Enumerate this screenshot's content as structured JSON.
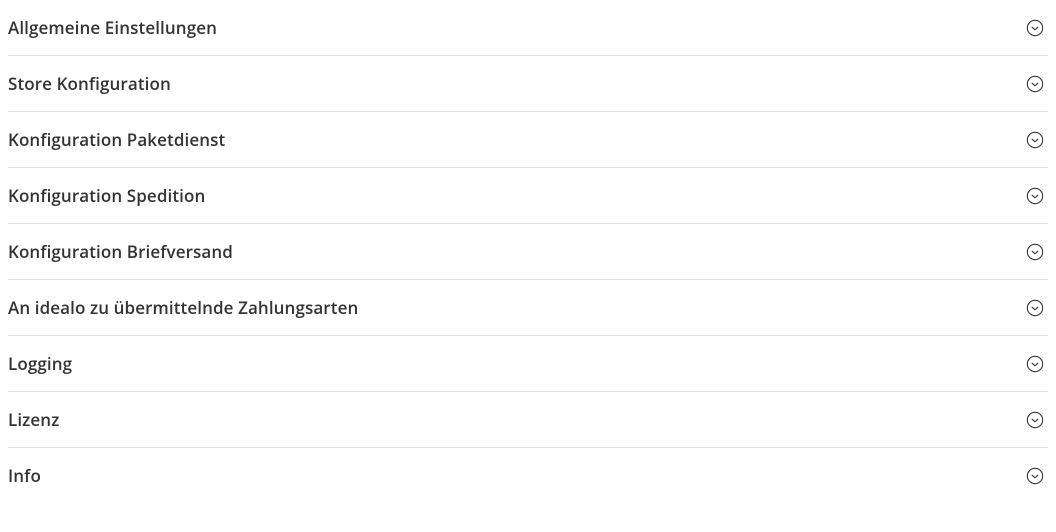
{
  "accordion": {
    "items": [
      {
        "label": "Allgemeine Einstellungen"
      },
      {
        "label": "Store Konfiguration"
      },
      {
        "label": "Konfiguration Paketdienst"
      },
      {
        "label": "Konfiguration Spedition"
      },
      {
        "label": "Konfiguration Briefversand"
      },
      {
        "label": "An idealo zu übermittelnde Zahlungsarten"
      },
      {
        "label": "Logging"
      },
      {
        "label": "Lizenz"
      },
      {
        "label": "Info"
      }
    ]
  }
}
